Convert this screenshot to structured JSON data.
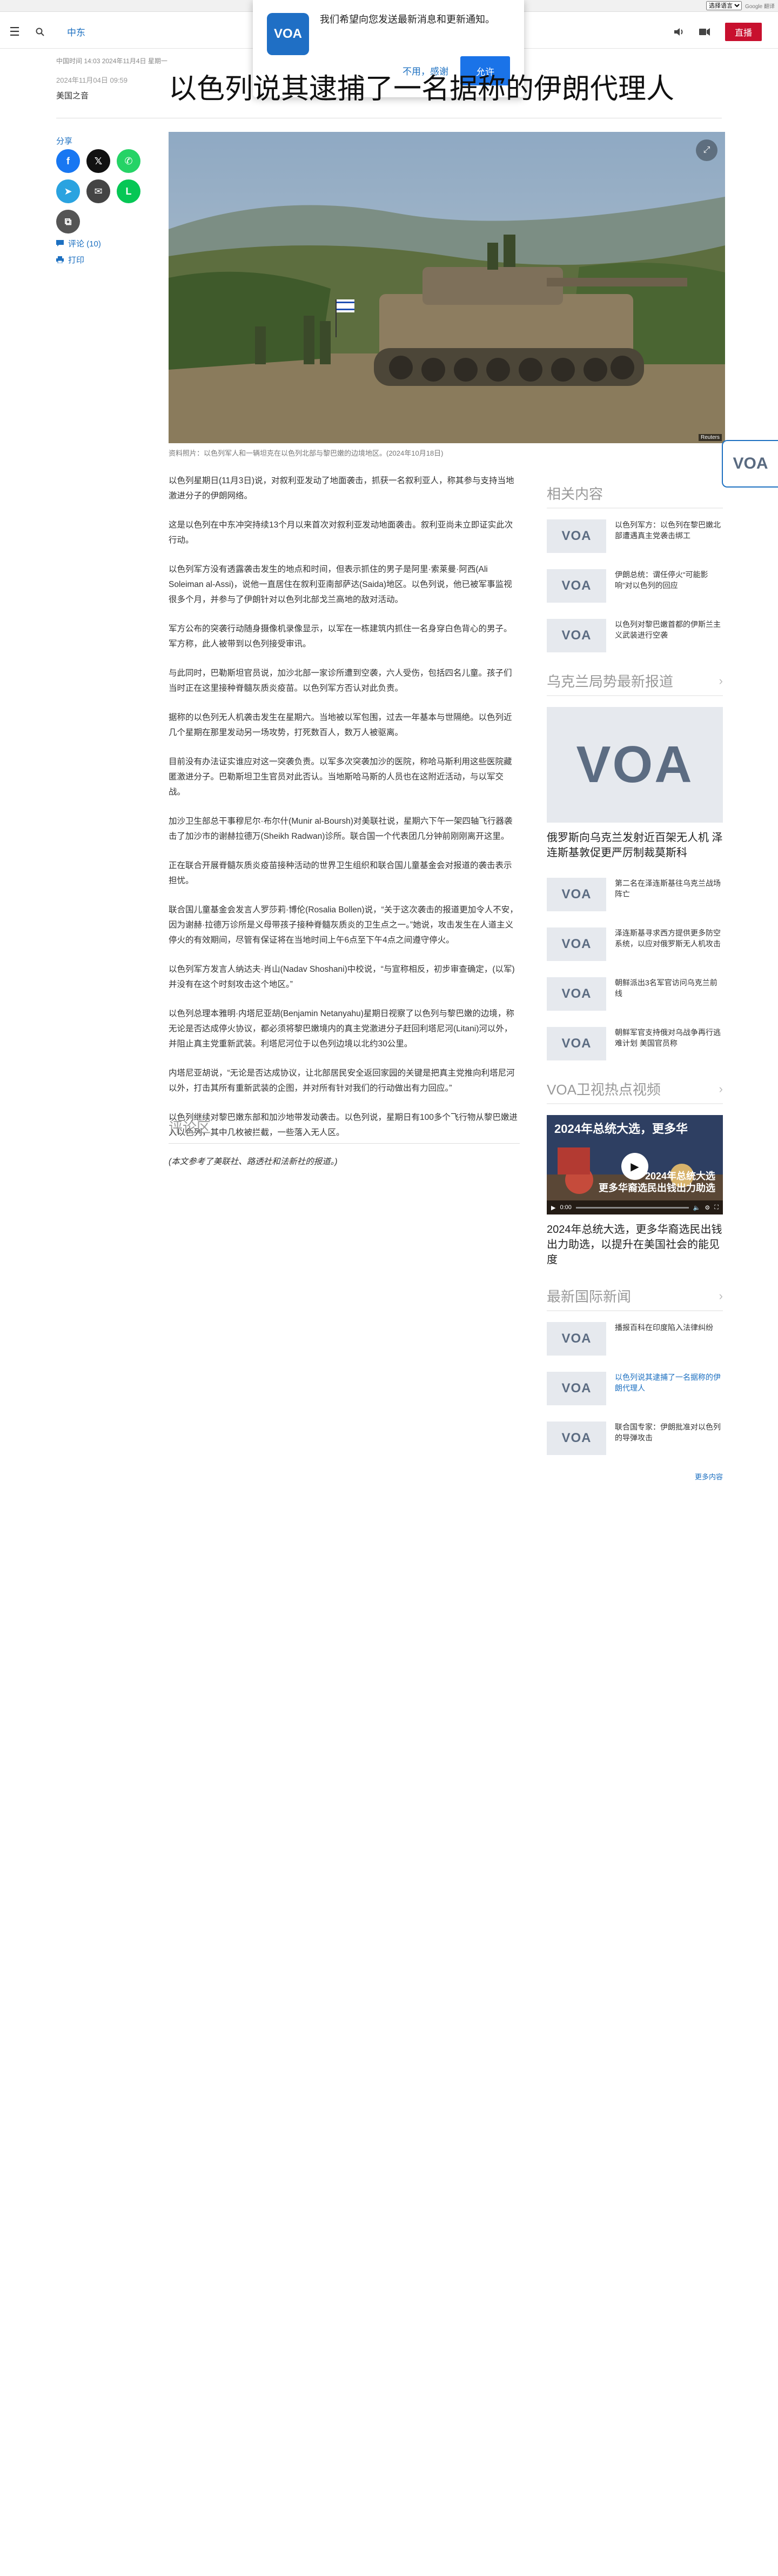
{
  "translate": {
    "select_label": "选择语言",
    "powered": "Google 翻译"
  },
  "header": {
    "menu_icon": "☰",
    "section": "中东",
    "live_label": "直播"
  },
  "notification": {
    "message": "我们希望向您发送最新消息和更新通知。",
    "decline": "不用，感谢",
    "accept": "允许",
    "logo_text": "VOA"
  },
  "article": {
    "dateline": "中国时间 14:03 2024年11月4日 星期一",
    "pubdate": "2024年11月04日 09:59",
    "author": "美国之音",
    "headline": "以色列说其逮捕了一名据称的伊朗代理人",
    "image_caption": "资料照片：以色列军人和一辆坦克在以色列北部与黎巴嫩的边境地区。(2024年10月18日)",
    "image_credit": "Reuters",
    "paragraphs": [
      "以色列星期日(11月3日)说，对叙利亚发动了地面袭击，抓获一名叙利亚人，称其参与支持当地激进分子的伊朗网络。",
      "这是以色列在中东冲突持续13个月以来首次对叙利亚发动地面袭击。叙利亚尚未立即证实此次行动。",
      "以色列军方没有透露袭击发生的地点和时间，但表示抓住的男子是阿里·索莱曼·阿西(Ali Soleiman al-Assi)，说他一直居住在叙利亚南部萨达(Saida)地区。以色列说，他已被军事监视很多个月，并参与了伊朗针对以色列北部戈兰高地的敌对活动。",
      "军方公布的突袭行动随身摄像机录像显示，以军在一栋建筑内抓住一名身穿白色背心的男子。军方称，此人被带到以色列接受审讯。",
      "与此同时，巴勒斯坦官员说，加沙北部一家诊所遭到空袭，六人受伤，包括四名儿童。孩子们当时正在这里接种脊髓灰质炎疫苗。以色列军方否认对此负责。",
      "据称的以色列无人机袭击发生在星期六。当地被以军包围，过去一年基本与世隔绝。以色列近几个星期在那里发动另一场攻势，打死数百人，数万人被驱离。",
      "目前没有办法证实谁应对这一突袭负责。以军多次突袭加沙的医院，称哈马斯利用这些医院藏匿激进分子。巴勒斯坦卫生官员对此否认。当地斯哈马斯的人员也在这附近活动，与以军交战。",
      "加沙卫生部总干事穆尼尔·布尔什(Munir al-Boursh)对美联社说，星期六下午一架四轴飞行器袭击了加沙市的谢赫拉德万(Sheikh Radwan)诊所。联合国一个代表团几分钟前刚刚离开这里。",
      "正在联合开展脊髓灰质炎疫苗接种活动的世界卫生组织和联合国儿童基金会对报道的袭击表示担忧。",
      "联合国儿童基金会发言人罗莎莉·博伦(Rosalia Bollen)说，“关于这次袭击的报道更加令人不安，因为谢赫·拉德万诊所是义母带孩子接种脊髓灰质炎的卫生点之一。”她说，攻击发生在人道主义停火的有效期间，尽管有保证将在当地时间上午6点至下午4点之间遵守停火。",
      "以色列军方发言人纳达夫·肖山(Nadav Shoshani)中校说，“与宣称相反，初步审查确定，(以军)并没有在这个时刻攻击这个地区。”",
      "以色列总理本雅明·内塔尼亚胡(Benjamin Netanyahu)星期日视察了以色列与黎巴嫩的边境，称无论是否达成停火协议，都必须将黎巴嫩境内的真主党激进分子赶回利塔尼河(Litani)河以外，并阻止真主党重新武装。利塔尼河位于以色列边境以北约30公里。",
      "内塔尼亚胡说，“无论是否达成协议，让北部居民安全返回家园的关键是把真主党推向利塔尼河以外，打击其所有重新武装的企图，并对所有针对我们的行动做出有力回应。”",
      "以色列继续对黎巴嫩东部和加沙地带发动袭击。以色列说，星期日有100多个飞行物从黎巴嫩进入以色列，其中几枚被拦截，一些落入无人区。"
    ],
    "note": "(本文参考了美联社、路透社和法新社的报道。)",
    "comments_title": "评论区"
  },
  "share": {
    "label": "分享",
    "buttons": [
      {
        "name": "facebook",
        "glyph": "f"
      },
      {
        "name": "x",
        "glyph": "𝕏"
      },
      {
        "name": "whatsapp",
        "glyph": "✆"
      },
      {
        "name": "telegram",
        "glyph": "➤"
      },
      {
        "name": "email",
        "glyph": "✉"
      },
      {
        "name": "line",
        "glyph": "L"
      },
      {
        "name": "copy-link",
        "glyph": "⧉"
      }
    ],
    "comments_link": "评论 (10)",
    "print_link": "打印"
  },
  "sidebar": {
    "related": {
      "title": "相关内容",
      "items": [
        "以色列军方：以色列在黎巴嫩北部遭遇真主党袭击绑工",
        "伊朗总统：谓任停火“可能影响”对以色列的回应",
        "以色列对黎巴嫩首都的伊斯兰主义武装进行空袭"
      ]
    },
    "ukraine": {
      "title": "乌克兰局势最新报道",
      "feature_title": "俄罗斯向乌克兰发射近百架无人机 泽连斯基敦促更严厉制裁莫斯科",
      "items": [
        "第二名在泽连斯基往乌克兰战场阵亡",
        "泽连斯基寻求西方提供更多防空系统，以应对俄罗斯无人机攻击",
        "朝鲜派出3名军官访问乌克兰前线",
        "朝鲜军官支持俄对乌战争再行逃难计划 美国官员称"
      ]
    },
    "video": {
      "title": "VOA卫视热点视频",
      "overlay_title": "2024年总统大选，更多华",
      "overlay_sub": "2024年总统大选\n更多华裔选民出钱出力助选",
      "time": "0:00",
      "caption": "2024年总统大选，更多华裔选民出钱出力助选，以提升在美国社会的能见度",
      "progress": 0
    },
    "intl": {
      "title": "最新国际新闻",
      "items": [
        {
          "text": "播报百科在印度陷入法律纠纷",
          "blue": false
        },
        {
          "text": "以色列说其逮捕了一名据称的伊朗代理人",
          "blue": true
        },
        {
          "text": "联合国专家：伊朗批准对以色列的导弹攻击",
          "blue": false
        }
      ],
      "more": "更多内容"
    }
  },
  "float_tab": {
    "logo": "VOA"
  },
  "colors": {
    "brand_blue": "#1d70c1",
    "live_red": "#c8102e",
    "accent_blue": "#1a73e8"
  }
}
